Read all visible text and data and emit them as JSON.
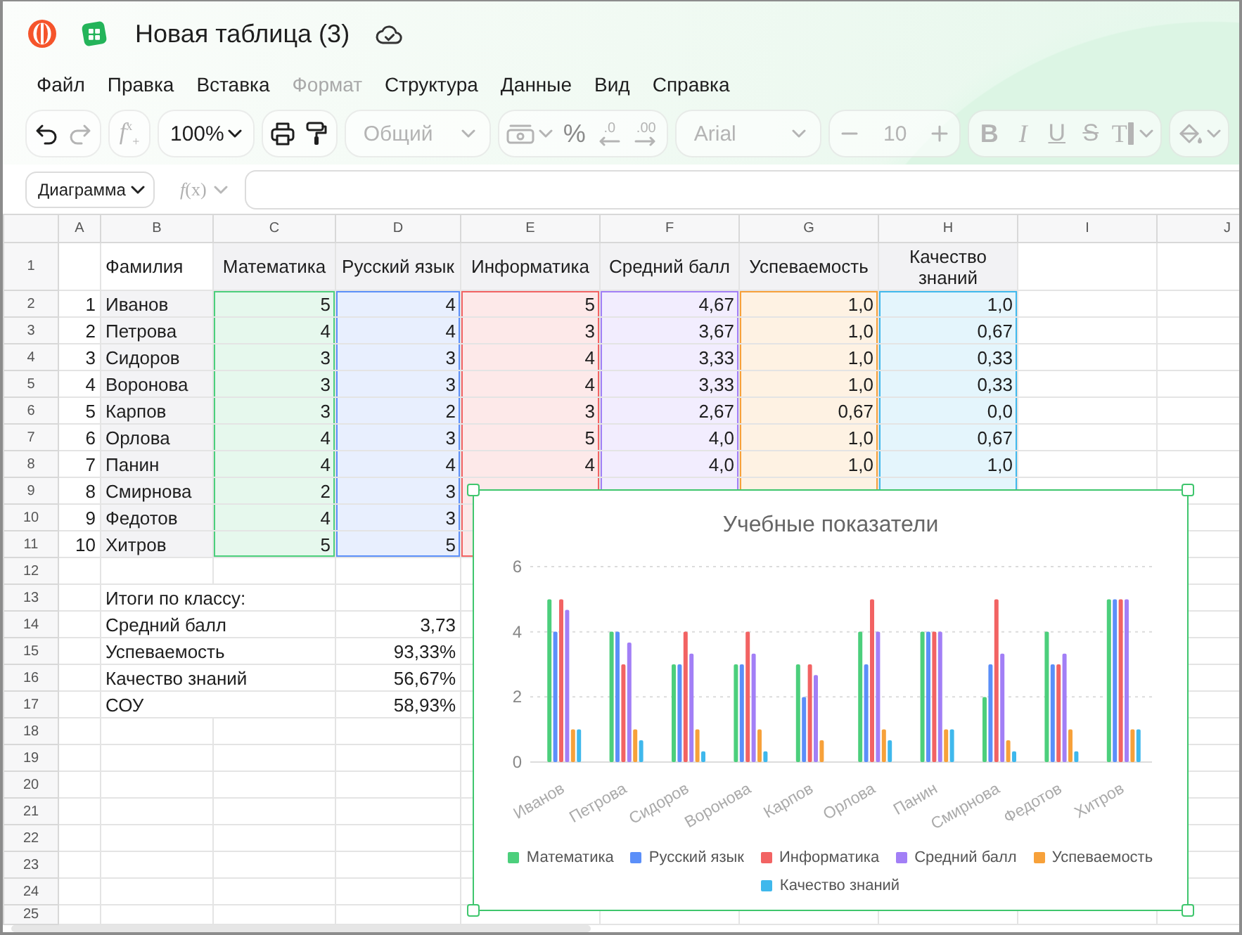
{
  "window": {
    "title": "Новая таблица (3)"
  },
  "menu": [
    {
      "label": "Файл",
      "disabled": false
    },
    {
      "label": "Правка",
      "disabled": false
    },
    {
      "label": "Вставка",
      "disabled": false
    },
    {
      "label": "Формат",
      "disabled": true
    },
    {
      "label": "Структура",
      "disabled": false
    },
    {
      "label": "Данные",
      "disabled": false
    },
    {
      "label": "Вид",
      "disabled": false
    },
    {
      "label": "Справка",
      "disabled": false
    }
  ],
  "toolbar": [
    {
      "items": [
        {
          "kind": "undo",
          "disabled": false
        },
        {
          "kind": "redo",
          "disabled": true
        }
      ]
    },
    {
      "items": [
        {
          "kind": "insert-function",
          "label": "f$^{x}$$_{+}$",
          "disabled": true
        }
      ]
    },
    {
      "items": [
        {
          "kind": "zoom",
          "value": "100%",
          "disabled": false
        }
      ]
    },
    {
      "items": [
        {
          "kind": "print",
          "disabled": false
        },
        {
          "kind": "paint-format",
          "disabled": false
        }
      ]
    },
    {
      "items": [
        {
          "kind": "number-format",
          "value": "Общий",
          "disabled": true
        }
      ]
    },
    {
      "items": [
        {
          "kind": "currency",
          "disabled": true
        },
        {
          "kind": "percent",
          "label": "%",
          "disabled": true
        },
        {
          "kind": "decrease-decimals",
          "label": ".0",
          "disabled": true
        },
        {
          "kind": "increase-decimals",
          "label": ".00",
          "disabled": true
        }
      ]
    },
    {
      "items": [
        {
          "kind": "font",
          "value": "Arial",
          "disabled": true
        }
      ]
    },
    {
      "items": [
        {
          "kind": "font-size-down",
          "disabled": true
        },
        {
          "kind": "font-size",
          "value": "10",
          "disabled": true
        },
        {
          "kind": "font-size-up",
          "disabled": true
        }
      ]
    },
    {
      "items": [
        {
          "kind": "bold",
          "label": "B",
          "disabled": true
        },
        {
          "kind": "italic",
          "label": "I",
          "disabled": true
        },
        {
          "kind": "underline",
          "label": "U",
          "disabled": true
        },
        {
          "kind": "strikethrough",
          "label": "S",
          "disabled": true
        },
        {
          "kind": "text-color",
          "label": "T",
          "disabled": true
        }
      ]
    },
    {
      "items": [
        {
          "kind": "fill-color",
          "disabled": true
        }
      ]
    }
  ],
  "formula_bar": {
    "name_box": "Диаграмма",
    "function_label": "*f*(x)"
  },
  "sheet": {
    "column_letters": [
      "A",
      "B",
      "C",
      "D",
      "E",
      "F",
      "G",
      "H",
      "I",
      "J"
    ],
    "row_numbers": [
      "1",
      "2",
      "3",
      "4",
      "5",
      "6",
      "7",
      "8",
      "9",
      "10",
      "11",
      "12",
      "13",
      "14",
      "15",
      "16",
      "17",
      "18",
      "19",
      "20",
      "21",
      "22",
      "23",
      "24",
      "25"
    ],
    "headers": [
      "Фамилия",
      "Математика",
      "Русский язык",
      "Информатика",
      "Средний балл",
      "Успеваемость",
      "Качество знаний"
    ],
    "students": [
      {
        "number": "1",
        "name": "Иванов",
        "marks": [
          "5",
          "4",
          "5",
          "4,67",
          "1,0",
          "1,0"
        ]
      },
      {
        "number": "2",
        "name": "Петрова",
        "marks": [
          "4",
          "4",
          "3",
          "3,67",
          "1,0",
          "0,67"
        ]
      },
      {
        "number": "3",
        "name": "Сидоров",
        "marks": [
          "3",
          "3",
          "4",
          "3,33",
          "1,0",
          "0,33"
        ]
      },
      {
        "number": "4",
        "name": "Воронова",
        "marks": [
          "3",
          "3",
          "4",
          "3,33",
          "1,0",
          "0,33"
        ]
      },
      {
        "number": "5",
        "name": "Карпов",
        "marks": [
          "3",
          "2",
          "3",
          "2,67",
          "0,67",
          "0,0"
        ]
      },
      {
        "number": "6",
        "name": "Орлова",
        "marks": [
          "4",
          "3",
          "5",
          "4,0",
          "1,0",
          "0,67"
        ]
      },
      {
        "number": "7",
        "name": "Панин",
        "marks": [
          "4",
          "4",
          "4",
          "4,0",
          "1,0",
          "1,0"
        ]
      },
      {
        "number": "8",
        "name": "Смирнова",
        "marks": [
          "2",
          "3"
        ]
      },
      {
        "number": "9",
        "name": "Федотов",
        "marks": [
          "4",
          "3"
        ]
      },
      {
        "number": "10",
        "name": "Хитров",
        "marks": [
          "5",
          "5"
        ]
      }
    ],
    "summary_title": "Итоги по классу:",
    "summary": [
      {
        "label": "Средний балл",
        "value": "3,73"
      },
      {
        "label": "Успеваемость",
        "value": "93,33%"
      },
      {
        "label": "Качество знаний",
        "value": "56,67%"
      },
      {
        "label": "СОУ",
        "value": "58,93%"
      }
    ],
    "chart": {
      "selected": true,
      "chart_data": {
        "type": "bar",
        "title": "Учебные показатели",
        "categories": [
          "Иванов",
          "Петрова",
          "Сидоров",
          "Воронова",
          "Карпов",
          "Орлова",
          "Панин",
          "Смирнова",
          "Федотов",
          "Хитров"
        ],
        "series": [
          {
            "name": "Математика",
            "color": "#4ccf7c",
            "values": [
              5,
              4,
              3,
              3,
              3,
              4,
              4,
              2,
              4,
              5
            ]
          },
          {
            "name": "Русский язык",
            "color": "#5b8ff9",
            "values": [
              4,
              4,
              3,
              3,
              2,
              3,
              4,
              3,
              3,
              5
            ]
          },
          {
            "name": "Информатика",
            "color": "#f26363",
            "values": [
              5,
              3,
              4,
              4,
              3,
              5,
              4,
              5,
              3,
              5
            ]
          },
          {
            "name": "Средний балл",
            "color": "#a27ff6",
            "values": [
              4.67,
              3.67,
              3.33,
              3.33,
              2.67,
              4.0,
              4.0,
              3.33,
              3.33,
              5.0
            ]
          },
          {
            "name": "Успеваемость",
            "color": "#f7a13a",
            "values": [
              1,
              1,
              1,
              1,
              0.67,
              1,
              1,
              0.67,
              1,
              1
            ]
          },
          {
            "name": "Качество знаний",
            "color": "#3fb8ec",
            "values": [
              1,
              0.67,
              0.33,
              0.33,
              0,
              0.67,
              1,
              0.33,
              0.33,
              1
            ]
          }
        ],
        "ylim": [
          0,
          6
        ],
        "yticks": [
          0,
          2,
          4,
          6
        ],
        "legend": "bottom"
      }
    }
  }
}
